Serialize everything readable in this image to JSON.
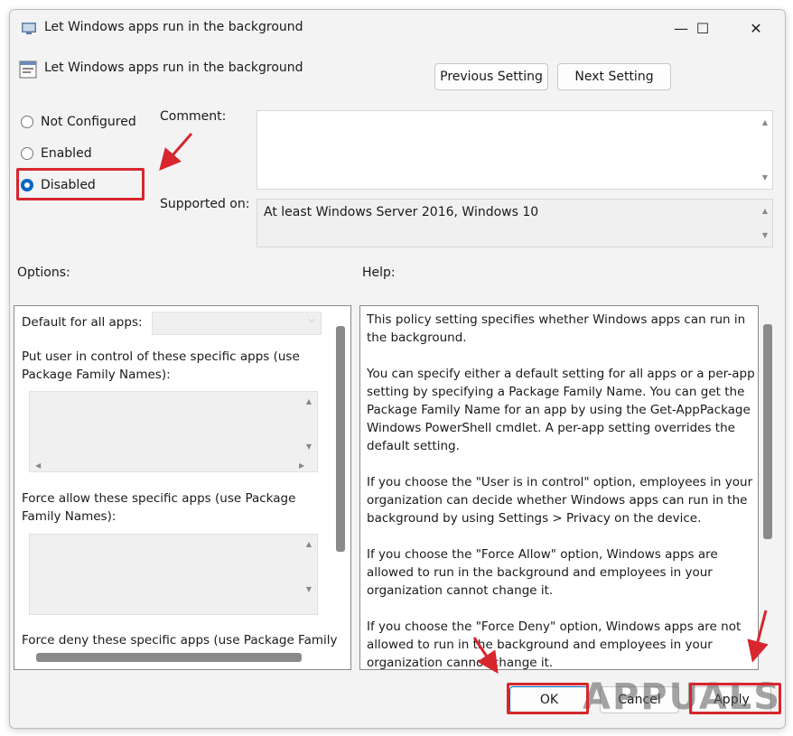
{
  "window": {
    "title": "Let Windows apps run in the background",
    "controls": {
      "minimize": "—",
      "maximize": "☐",
      "close": "✕"
    }
  },
  "header": {
    "setting_name": "Let Windows apps run in the background",
    "previous_label": "Previous Setting",
    "next_label": "Next Setting"
  },
  "state": {
    "options": [
      {
        "label": "Not Configured",
        "selected": false
      },
      {
        "label": "Enabled",
        "selected": false
      },
      {
        "label": "Disabled",
        "selected": true
      }
    ]
  },
  "comment": {
    "label": "Comment:",
    "value": ""
  },
  "supported": {
    "label": "Supported on:",
    "value": "At least Windows Server 2016, Windows 10"
  },
  "options_panel": {
    "label": "Options:",
    "default_label": "Default for all apps:",
    "default_value": "",
    "user_control_label": "Put user in control of these specific apps (use Package Family Names):",
    "force_allow_label": "Force allow these specific apps (use Package Family Names):",
    "force_deny_label": "Force deny these specific apps (use Package Family"
  },
  "help_panel": {
    "label": "Help:",
    "paragraphs": [
      "This policy setting specifies whether Windows apps can run in the background.",
      "You can specify either a default setting for all apps or a per-app setting by specifying a Package Family Name. You can get the Package Family Name for an app by using the Get-AppPackage Windows PowerShell cmdlet. A per-app setting overrides the default setting.",
      "If you choose the \"User is in control\" option, employees in your organization can decide whether Windows apps can run in the background by using Settings > Privacy on the device.",
      "If you choose the \"Force Allow\" option, Windows apps are allowed to run in the background and employees in your organization cannot change it.",
      "If you choose the \"Force Deny\" option, Windows apps are not allowed to run in the background and employees in your organization cannot change it."
    ]
  },
  "footer": {
    "ok_label": "OK",
    "cancel_label": "Cancel",
    "apply_label": "Apply"
  },
  "watermark": {
    "text": "APPUALS"
  },
  "colors": {
    "accent": "#0067c0",
    "annotation": "#d7262e"
  }
}
